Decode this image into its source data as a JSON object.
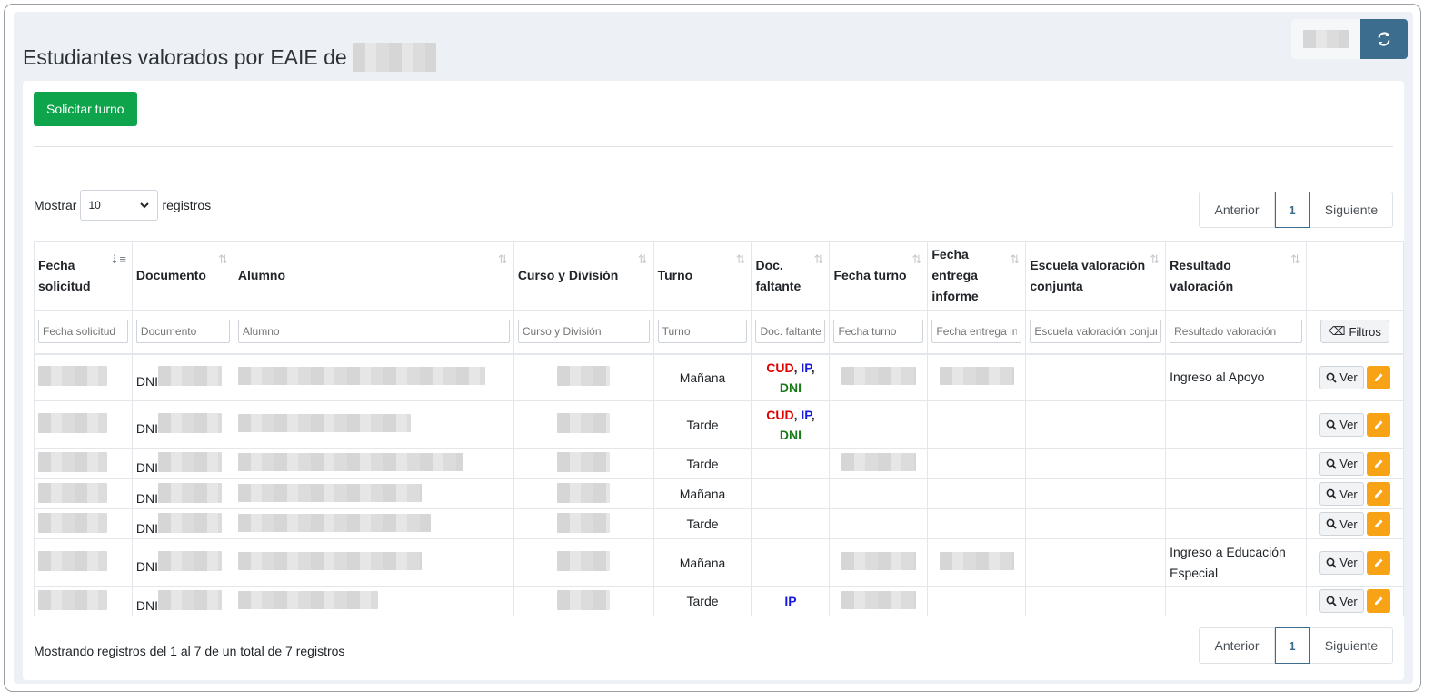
{
  "header": {
    "title": "Estudiantes valorados por EAIE de",
    "refresh_icon": "refresh-icon"
  },
  "toolbar": {
    "solicitar_label": "Solicitar turno"
  },
  "length_menu": {
    "prefix": "Mostrar",
    "value": "10",
    "suffix": "registros"
  },
  "pagination": {
    "prev": "Anterior",
    "current": "1",
    "next": "Siguiente"
  },
  "columns": [
    "Fecha solicitud",
    "Documento",
    "Alumno",
    "Curso y División",
    "Turno",
    "Doc. faltante",
    "Fecha turno",
    "Fecha entrega informe",
    "Escuela valoración conjunta",
    "Resultado valoración",
    ""
  ],
  "filters": {
    "fecha_solicitud": "Fecha solicitud",
    "documento": "Documento",
    "alumno": "Alumno",
    "curso": "Curso y División",
    "turno": "Turno",
    "doc_faltante": "Doc. faltante",
    "fecha_turno": "Fecha turno",
    "fecha_entrega": "Fecha entrega informe",
    "escuela": "Escuela valoración conjunta",
    "resultado": "Resultado valoración",
    "filtros_button": "Filtros"
  },
  "rows": [
    {
      "doc_prefix": "DNI",
      "turno": "Mañana",
      "docs": [
        "CUD",
        "IP",
        "DNI"
      ],
      "resultado": "Ingreso al Apoyo"
    },
    {
      "doc_prefix": "DNI",
      "turno": "Tarde",
      "docs": [
        "CUD",
        "IP",
        "DNI"
      ],
      "resultado": ""
    },
    {
      "doc_prefix": "DNI",
      "turno": "Tarde",
      "docs": [],
      "resultado": ""
    },
    {
      "doc_prefix": "DNI",
      "turno": "Mañana",
      "docs": [],
      "resultado": ""
    },
    {
      "doc_prefix": "DNI",
      "turno": "Tarde",
      "docs": [],
      "resultado": ""
    },
    {
      "doc_prefix": "DNI",
      "turno": "Mañana",
      "docs": [],
      "resultado": "Ingreso a Educación Especial"
    },
    {
      "doc_prefix": "DNI",
      "turno": "Tarde",
      "docs": [
        "IP"
      ],
      "resultado": ""
    }
  ],
  "row_actions": {
    "view_label": "Ver"
  },
  "footer_info": "Mostrando registros del 1 al 7 de un total de 7 registros",
  "colors": {
    "success": "#0ea44b",
    "primary": "#3c6d8f",
    "warning": "#f7a315",
    "cud": "#e00000",
    "ip": "#1a1ae6",
    "dni": "#1a7a1a"
  }
}
